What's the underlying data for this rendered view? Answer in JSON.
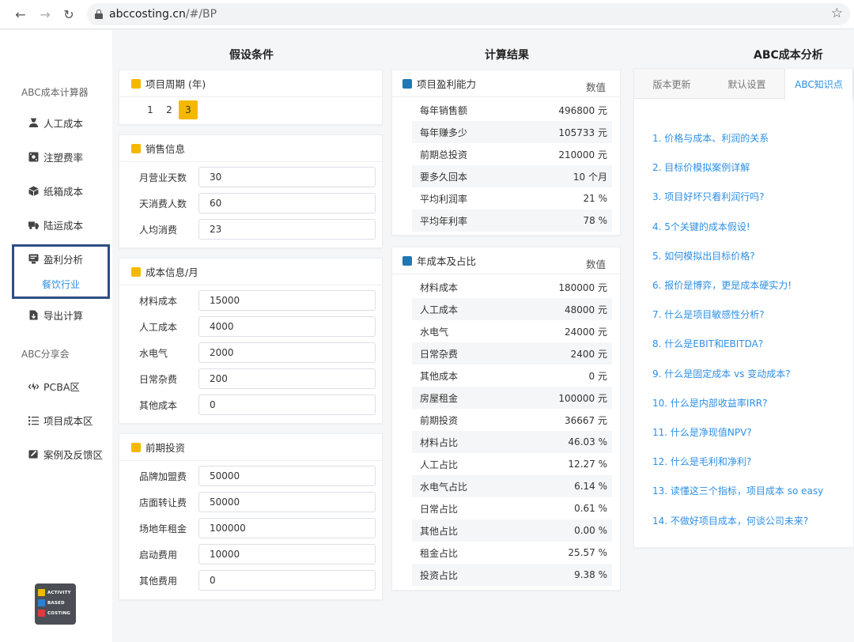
{
  "browser": {
    "url_host": "abccosting.cn",
    "url_path": "/#/BP"
  },
  "sidebar": {
    "group1_title": "ABC成本计算器",
    "items": [
      {
        "label": "人工成本",
        "icon": "worker-icon"
      },
      {
        "label": "注塑费率",
        "icon": "mold-icon"
      },
      {
        "label": "纸箱成本",
        "icon": "box-icon"
      },
      {
        "label": "陆运成本",
        "icon": "truck-icon"
      },
      {
        "label": "盈利分析",
        "icon": "chart-board-icon"
      },
      {
        "label": "导出计算",
        "icon": "export-file-icon"
      }
    ],
    "sub_item": "餐饮行业",
    "group2_title": "ABC分享会",
    "items2": [
      {
        "label": "PCBA区",
        "icon": "code-wave-icon"
      },
      {
        "label": "项目成本区",
        "icon": "list-icon"
      },
      {
        "label": "案例及反馈区",
        "icon": "edit-board-icon"
      }
    ],
    "logo": [
      "ACTIVITY",
      "BASED",
      "COSTING"
    ]
  },
  "columns": {
    "assumptions": "假设条件",
    "results": "计算结果",
    "abc": "ABC成本分析"
  },
  "period": {
    "title": "项目周期 (年)",
    "pages": [
      "1",
      "2",
      "3"
    ],
    "active": "3"
  },
  "sales": {
    "title": "销售信息",
    "fields": [
      {
        "label": "月营业天数",
        "value": "30"
      },
      {
        "label": "天消费人数",
        "value": "60"
      },
      {
        "label": "人均消费",
        "value": "23"
      }
    ]
  },
  "cost": {
    "title": "成本信息/月",
    "fields": [
      {
        "label": "材料成本",
        "value": "15000"
      },
      {
        "label": "人工成本",
        "value": "4000"
      },
      {
        "label": "水电气",
        "value": "2000"
      },
      {
        "label": "日常杂费",
        "value": "200"
      },
      {
        "label": "其他成本",
        "value": "0"
      }
    ]
  },
  "invest": {
    "title": "前期投资",
    "fields": [
      {
        "label": "品牌加盟费",
        "value": "50000"
      },
      {
        "label": "店面转让费",
        "value": "50000"
      },
      {
        "label": "场地年租金",
        "value": "100000"
      },
      {
        "label": "启动费用",
        "value": "10000"
      },
      {
        "label": "其他费用",
        "value": "0"
      }
    ]
  },
  "profit": {
    "title": "项目盈利能力",
    "value_header": "数值",
    "rows": [
      {
        "label": "每年销售额",
        "value": "496800 元"
      },
      {
        "label": "每年赚多少",
        "value": "105733 元"
      },
      {
        "label": "前期总投资",
        "value": "210000 元"
      },
      {
        "label": "要多久回本",
        "value": "10 个月"
      },
      {
        "label": "平均利润率",
        "value": "21 %"
      },
      {
        "label": "平均年利率",
        "value": "78 %"
      }
    ]
  },
  "annual": {
    "title": "年成本及占比",
    "value_header": "数值",
    "rows": [
      {
        "label": "材料成本",
        "value": "180000 元"
      },
      {
        "label": "人工成本",
        "value": "48000 元"
      },
      {
        "label": "水电气",
        "value": "24000 元"
      },
      {
        "label": "日常杂费",
        "value": "2400 元"
      },
      {
        "label": "其他成本",
        "value": "0 元"
      },
      {
        "label": "房屋租金",
        "value": "100000 元"
      },
      {
        "label": "前期投资",
        "value": "36667 元"
      },
      {
        "label": "材料占比",
        "value": "46.03 %"
      },
      {
        "label": "人工占比",
        "value": "12.27 %"
      },
      {
        "label": "水电气占比",
        "value": "6.14 %"
      },
      {
        "label": "日常占比",
        "value": "0.61 %"
      },
      {
        "label": "其他占比",
        "value": "0.00 %"
      },
      {
        "label": "租金占比",
        "value": "25.57 %"
      },
      {
        "label": "投资占比",
        "value": "9.38 %"
      }
    ]
  },
  "tabs": [
    "版本更新",
    "默认设置",
    "ABC知识点"
  ],
  "tab_active": "ABC知识点",
  "knowledge": [
    "1. 价格与成本、利润的关系",
    "2. 目标价模拟案例详解",
    "3. 项目好坏只看利润行吗?",
    "4. 5个关键的成本假设!",
    "5. 如何模拟出目标价格?",
    "6. 报价是博弈，更是成本硬实力!",
    "7. 什么是项目敏感性分析?",
    "8. 什么是EBIT和EBITDA?",
    "9. 什么是固定成本 vs 变动成本?",
    "10. 什么是内部收益率IRR?",
    "11. 什么是净现值NPV?",
    "12. 什么是毛利和净利?",
    "13. 读懂这三个指标，项目成本 so easy",
    "14. 不做好项目成本，何谈公司未来?"
  ]
}
